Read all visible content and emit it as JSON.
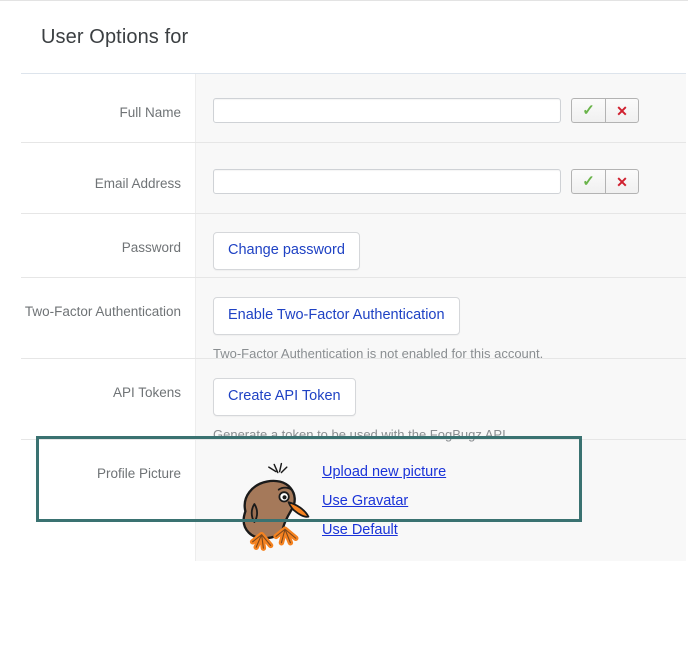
{
  "header": {
    "title": "User Options for"
  },
  "rows": [
    {
      "key": "full_name",
      "label": "Full Name",
      "input_value": "",
      "placeholder": "",
      "accept_icon": "check-icon",
      "reject_icon": "close-icon"
    },
    {
      "key": "email_address",
      "label": "Email Address",
      "input_value": "",
      "placeholder": "",
      "accept_icon": "check-icon",
      "reject_icon": "close-icon"
    },
    {
      "key": "password",
      "label": "Password",
      "button": "Change password"
    },
    {
      "key": "two_factor",
      "label": "Two-Factor Authentication",
      "button": "Enable Two-Factor Authentication",
      "helper": "Two-Factor Authentication is not enabled for this account."
    },
    {
      "key": "api_tokens",
      "label": "API Tokens",
      "button": "Create API Token",
      "helper": "Generate a token to be used with the FogBugz API.",
      "highlighted": true
    },
    {
      "key": "profile_picture",
      "label": "Profile Picture",
      "avatar_icon": "kiwi-bird-avatar",
      "links": [
        "Upload new picture",
        "Use Gravatar",
        "Use Default"
      ]
    }
  ],
  "colors": {
    "link": "#1a33d8",
    "button_text": "#1f42c4",
    "label_text": "#6f7376",
    "helper_text": "#8a8e91",
    "highlight_border": "#3a7271",
    "check_green": "#6ab44a",
    "x_red": "#d0202f",
    "content_bg": "#f8f8f8",
    "label_bg": "#ffffff"
  },
  "icons": {
    "check": "✓",
    "close": "✕"
  }
}
